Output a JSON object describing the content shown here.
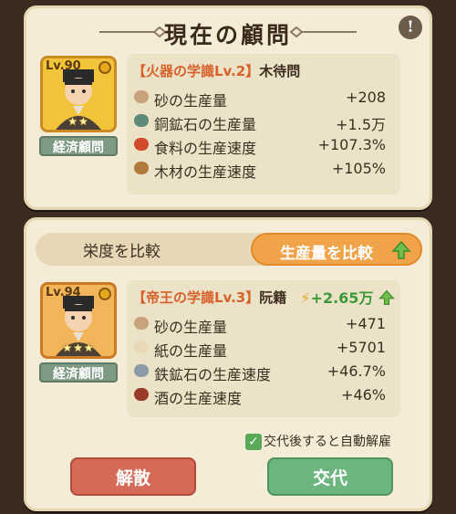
{
  "header": {
    "title": "現在の顧問",
    "info_icon": "!"
  },
  "current_advisor": {
    "level": "Lv.90",
    "stars": "★★",
    "role": "経済顧問",
    "skill_prefix": "【火器の学識Lv.2】",
    "name": "木待問",
    "stats": [
      {
        "icon": "sand-icon",
        "label": "砂の生産量",
        "value": "+208"
      },
      {
        "icon": "copper-ore-icon",
        "label": "銅鉱石の生産量",
        "value": "+1.5万"
      },
      {
        "icon": "food-icon",
        "label": "食料の生産速度",
        "value": "+107.3%"
      },
      {
        "icon": "wood-icon",
        "label": "木材の生産速度",
        "value": "+105%"
      }
    ]
  },
  "compare": {
    "left_tab": "栄度を比較",
    "right_tab": "生産量を比較"
  },
  "candidate_advisor": {
    "level": "Lv.94",
    "stars": "★★★",
    "role": "経済顧問",
    "skill_prefix": "【帝王の学識Lv.3】",
    "name": "阮籍",
    "gain": "+2.65万",
    "stats": [
      {
        "icon": "sand-icon",
        "label": "砂の生産量",
        "value": "+471"
      },
      {
        "icon": "paper-icon",
        "label": "紙の生産量",
        "value": "+5701"
      },
      {
        "icon": "iron-ore-icon",
        "label": "鉄鉱石の生産速度",
        "value": "+46.7%"
      },
      {
        "icon": "wine-icon",
        "label": "酒の生産速度",
        "value": "+46%"
      }
    ]
  },
  "auto_option_label": "交代後すると自動解雇",
  "buttons": {
    "dismiss": "解散",
    "swap": "交代"
  },
  "colors": {
    "panel": "#f4ecd6",
    "accent_orange": "#f0a348",
    "green": "#6cb57e",
    "red": "#d46a57"
  }
}
